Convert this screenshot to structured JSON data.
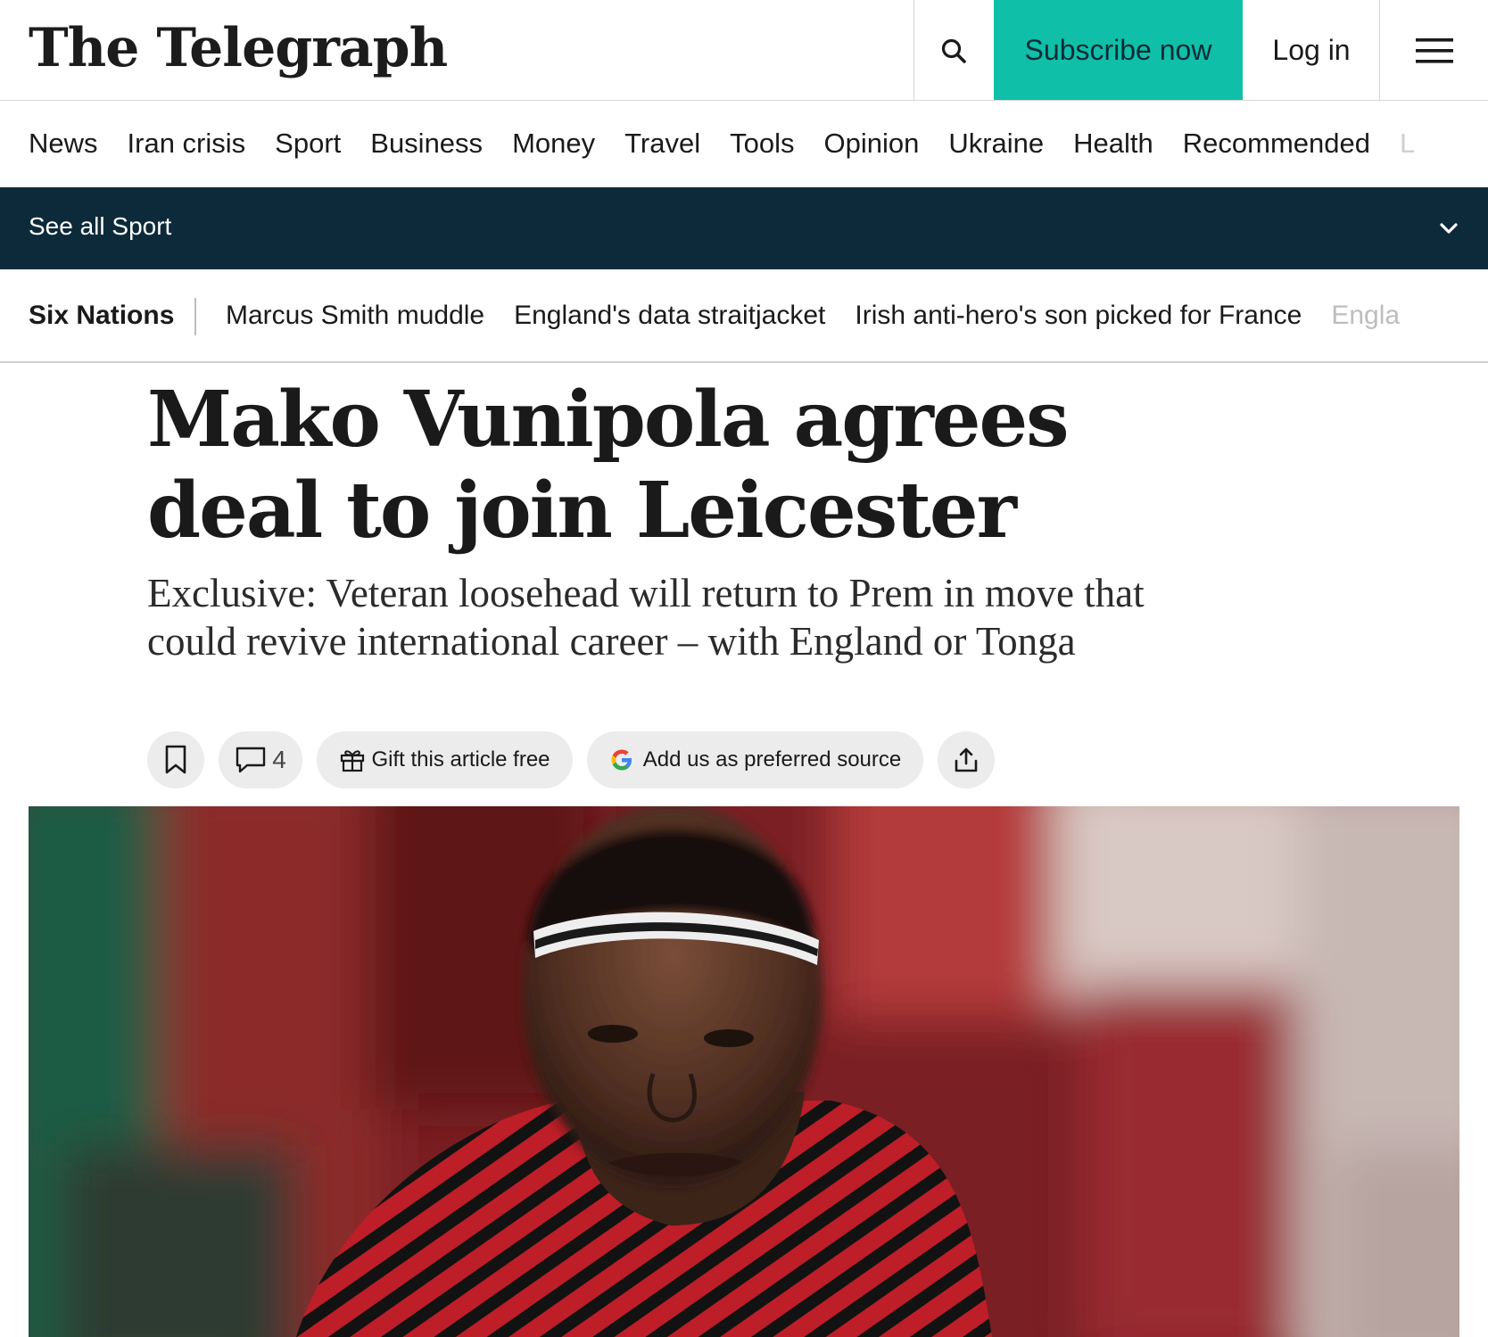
{
  "header": {
    "logo_text": "The Telegraph",
    "search_icon": "search-icon",
    "subscribe_label": "Subscribe now",
    "login_label": "Log in",
    "menu_icon": "hamburger-menu-icon",
    "accent_color": "#0fbfa8"
  },
  "main_nav": {
    "items": [
      "News",
      "Iran crisis",
      "Sport",
      "Business",
      "Money",
      "Travel",
      "Tools",
      "Opinion",
      "Ukraine",
      "Health",
      "Recommended",
      "L"
    ]
  },
  "sport_bar": {
    "label": "See all Sport",
    "chevron_icon": "chevron-down-icon",
    "background_color": "#0d2a3a"
  },
  "sub_nav": {
    "section": "Six Nations",
    "items": [
      "Marcus Smith muddle",
      "England's data straitjacket",
      "Irish anti-hero's son picked for France",
      "Engla"
    ]
  },
  "article": {
    "headline": "Mako Vunipola agrees deal to join Leicester",
    "standfirst": "Exclusive: Veteran loosehead will return to Prem in move that could revive international career – with England or Tonga",
    "comment_count": "4",
    "gift_label": "Gift this article free",
    "preferred_source_label": "Add us as preferred source"
  }
}
